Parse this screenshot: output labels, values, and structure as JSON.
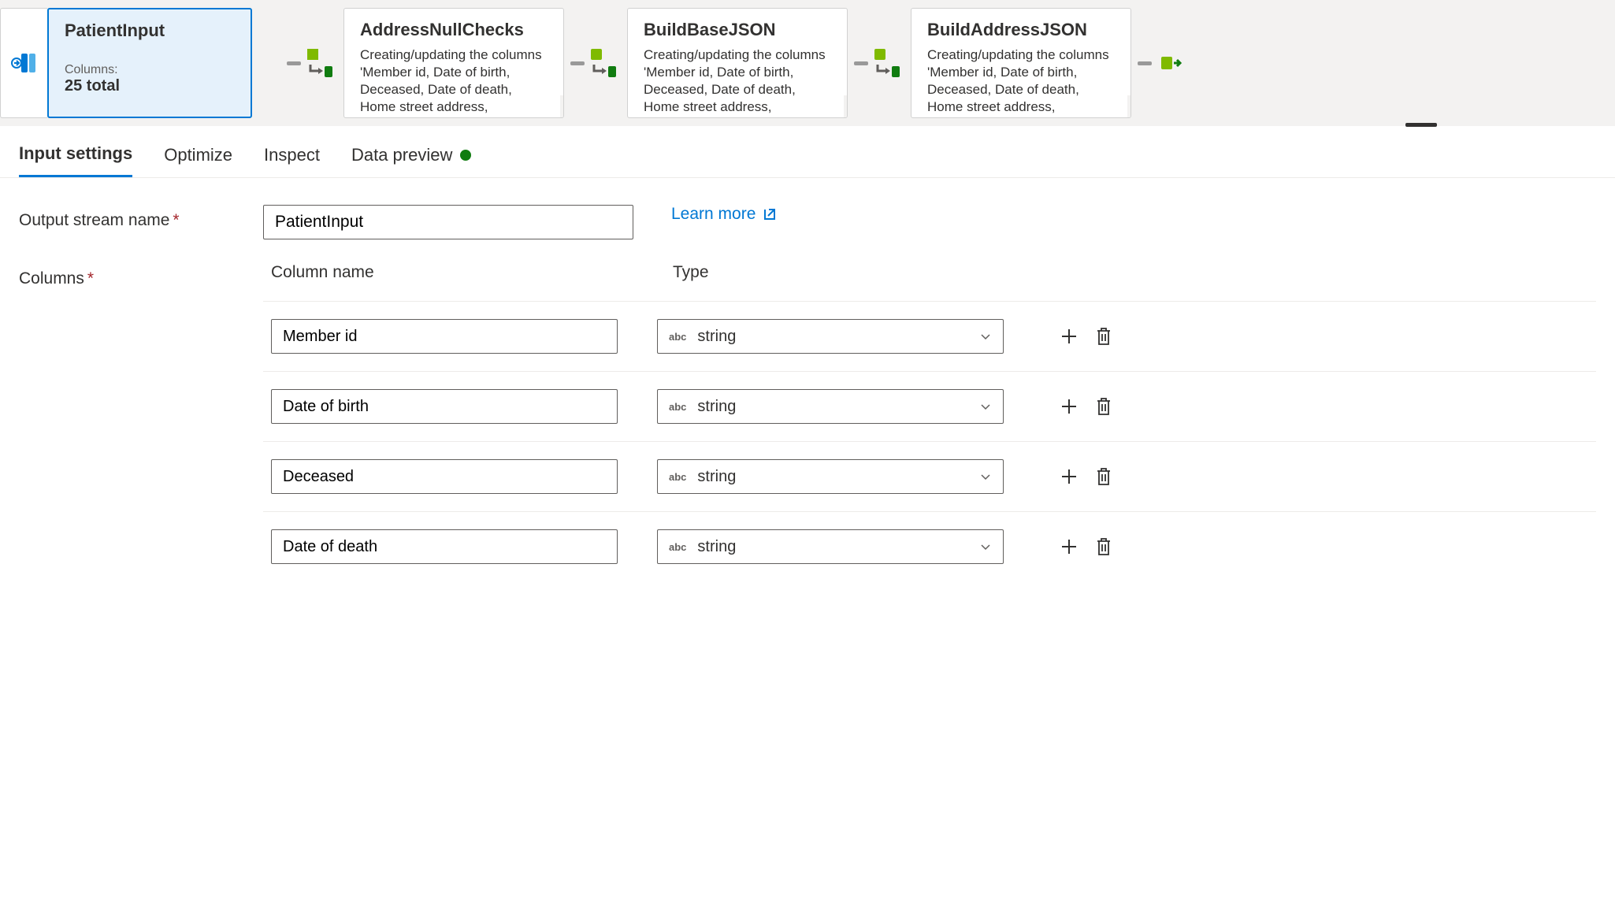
{
  "pipeline": {
    "nodes": [
      {
        "title": "PatientInput",
        "columns_label": "Columns:",
        "columns_value": "25 total",
        "selected": true
      },
      {
        "title": "AddressNullChecks",
        "desc": "Creating/updating the columns 'Member id, Date of birth, Deceased, Date of death, Home street address,"
      },
      {
        "title": "BuildBaseJSON",
        "desc": "Creating/updating the columns 'Member id, Date of birth, Deceased, Date of death, Home street address,"
      },
      {
        "title": "BuildAddressJSON",
        "desc": "Creating/updating the columns 'Member id, Date of birth, Deceased, Date of death, Home street address,"
      }
    ]
  },
  "tabs": [
    {
      "label": "Input settings",
      "active": true
    },
    {
      "label": "Optimize"
    },
    {
      "label": "Inspect"
    },
    {
      "label": "Data preview",
      "status": true
    }
  ],
  "form": {
    "output_stream_label": "Output stream name",
    "output_stream_value": "PatientInput",
    "learn_more": "Learn more",
    "columns_label": "Columns",
    "column_name_header": "Column name",
    "type_header": "Type",
    "rows": [
      {
        "name": "Member id",
        "type": "string"
      },
      {
        "name": "Date of birth",
        "type": "string"
      },
      {
        "name": "Deceased",
        "type": "string"
      },
      {
        "name": "Date of death",
        "type": "string"
      }
    ],
    "type_icon_label": "abc"
  }
}
